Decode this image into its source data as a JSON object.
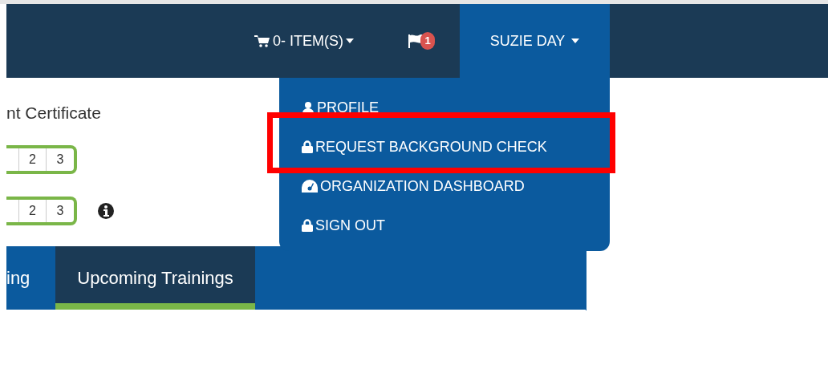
{
  "header": {
    "cart": {
      "label": "0- ITEM(S)"
    },
    "notifications": {
      "count": "1"
    },
    "user": {
      "name": "SUZIE DAY",
      "expanded": true
    }
  },
  "user_menu": [
    {
      "kind": "user",
      "label": "PROFILE",
      "highlighted": false
    },
    {
      "kind": "lock",
      "label": "REQUEST BACKGROUND CHECK",
      "highlighted": true
    },
    {
      "kind": "dashboard",
      "label": "ORGANIZATION DASHBOARD",
      "highlighted": false
    },
    {
      "kind": "lock",
      "label": "SIGN OUT",
      "highlighted": false
    }
  ],
  "content": {
    "title": "nt Certificate",
    "pagers": [
      {
        "pages": [
          "2",
          "3"
        ],
        "info": false
      },
      {
        "pages": [
          "2",
          "3"
        ],
        "info": true
      }
    ]
  },
  "tabs": [
    {
      "label": "ing",
      "selected": false
    },
    {
      "label": "Upcoming Trainings",
      "selected": true
    }
  ]
}
